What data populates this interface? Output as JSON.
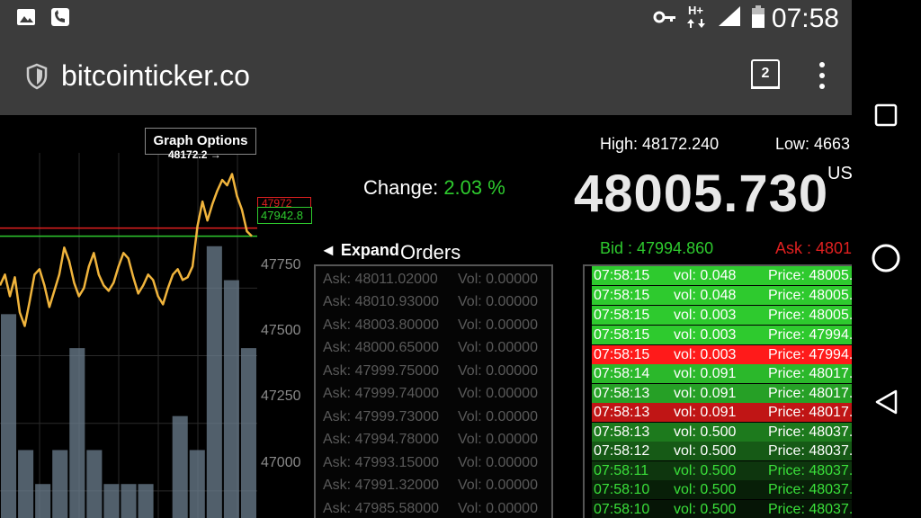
{
  "status_bar": {
    "time": "07:58",
    "network": "H+"
  },
  "browser": {
    "url": "bitcointicker.co",
    "tab_count": "2"
  },
  "ticker": {
    "high_label": "High: 48172.240",
    "low_label": "Low: 4663",
    "change_label": "Change:",
    "change_value": "2.03 %",
    "price": "48005.730",
    "currency": "US",
    "bid_label": "Bid  : 47994.860",
    "ask_label": "Ask : 4801"
  },
  "chart": {
    "graph_options_label": "Graph Options",
    "peak_label": "48172.2 →",
    "last_red_label": "47972",
    "last_green_label": "47942.8",
    "y_ticks": [
      "47750",
      "47500",
      "47250",
      "47000"
    ],
    "colors": {
      "line": "#f0b43c",
      "grid": "#2a2a2a",
      "bars": "#6c7f8f"
    }
  },
  "chart_data": {
    "type": "line",
    "title": "",
    "ylabel": "",
    "ylim": [
      46900,
      48250
    ],
    "y_ticks": [
      47750,
      47500,
      47250,
      47000
    ],
    "series": [
      {
        "values": [
          47760,
          47800,
          47720,
          47790,
          47660,
          47610,
          47700,
          47800,
          47820,
          47760,
          47680,
          47740,
          47800,
          47900,
          47850,
          47770,
          47720,
          47750,
          47830,
          47880,
          47800,
          47760,
          47740,
          47770,
          47830,
          47880,
          47860,
          47790,
          47730,
          47760,
          47800,
          47780,
          47720,
          47690,
          47750,
          47800,
          47820,
          47780,
          47790,
          47830,
          47980,
          48070,
          48000,
          48060,
          48110,
          48150,
          48130,
          48172,
          48090,
          48040,
          47960,
          47942
        ]
      }
    ],
    "volume_bars": [
      6,
      2,
      1,
      2,
      5,
      2,
      1,
      1,
      1,
      0,
      3,
      2,
      8,
      7,
      5
    ]
  },
  "orders": {
    "expand_label": "◄ Expand",
    "title": "Orders",
    "asks": [
      {
        "ask": "Ask:  48011.02000",
        "vol": "Vol: 0.00000"
      },
      {
        "ask": "Ask:  48010.93000",
        "vol": "Vol: 0.00000"
      },
      {
        "ask": "Ask:  48003.80000",
        "vol": "Vol: 0.00000"
      },
      {
        "ask": "Ask:  48000.65000",
        "vol": "Vol: 0.00000"
      },
      {
        "ask": "Ask:  47999.75000",
        "vol": "Vol: 0.00000"
      },
      {
        "ask": "Ask:  47999.74000",
        "vol": "Vol: 0.00000"
      },
      {
        "ask": "Ask:  47999.73000",
        "vol": "Vol: 0.00000"
      },
      {
        "ask": "Ask:  47994.78000",
        "vol": "Vol: 0.00000"
      },
      {
        "ask": "Ask:  47993.15000",
        "vol": "Vol: 0.00000"
      },
      {
        "ask": "Ask:  47991.32000",
        "vol": "Vol: 0.00000"
      },
      {
        "ask": "Ask:  47985.58000",
        "vol": "Vol: 0.00000"
      }
    ]
  },
  "trades": [
    {
      "time": "07:58:15",
      "vol": "vol: 0.048",
      "price": "Price: 48005.",
      "bg": "#2eca2e",
      "fg": "#ffffff"
    },
    {
      "time": "07:58:15",
      "vol": "vol: 0.048",
      "price": "Price: 48005.",
      "bg": "#2eca2e",
      "fg": "#ffffff"
    },
    {
      "time": "07:58:15",
      "vol": "vol: 0.003",
      "price": "Price: 48005.",
      "bg": "#2eca2e",
      "fg": "#ffffff"
    },
    {
      "time": "07:58:15",
      "vol": "vol: 0.003",
      "price": "Price: 47994.",
      "bg": "#2eca2e",
      "fg": "#ffffff"
    },
    {
      "time": "07:58:15",
      "vol": "vol: 0.003",
      "price": "Price: 47994.",
      "bg": "#ff1a1a",
      "fg": "#ffffff"
    },
    {
      "time": "07:58:14",
      "vol": "vol: 0.091",
      "price": "Price: 48017.",
      "bg": "#2bb82b",
      "fg": "#ffffff"
    },
    {
      "time": "07:58:13",
      "vol": "vol: 0.091",
      "price": "Price: 48017.",
      "bg": "#26a026",
      "fg": "#ffffff"
    },
    {
      "time": "07:58:13",
      "vol": "vol: 0.091",
      "price": "Price: 48017.",
      "bg": "#c01515",
      "fg": "#ffffff"
    },
    {
      "time": "07:58:13",
      "vol": "vol: 0.500",
      "price": "Price: 48037.",
      "bg": "#1d7a1d",
      "fg": "#ffffff"
    },
    {
      "time": "07:58:12",
      "vol": "vol: 0.500",
      "price": "Price: 48037.",
      "bg": "#165a16",
      "fg": "#ffffff"
    },
    {
      "time": "07:58:11",
      "vol": "vol: 0.500",
      "price": "Price: 48037.",
      "bg": "#0e360e",
      "fg": "#3ae03a"
    },
    {
      "time": "07:58:10",
      "vol": "vol: 0.500",
      "price": "Price: 48037.",
      "bg": "#081f08",
      "fg": "#3ae03a"
    },
    {
      "time": "07:58:10",
      "vol": "vol: 0.500",
      "price": "Price: 48037.",
      "bg": "#061506",
      "fg": "#3ae03a"
    }
  ]
}
